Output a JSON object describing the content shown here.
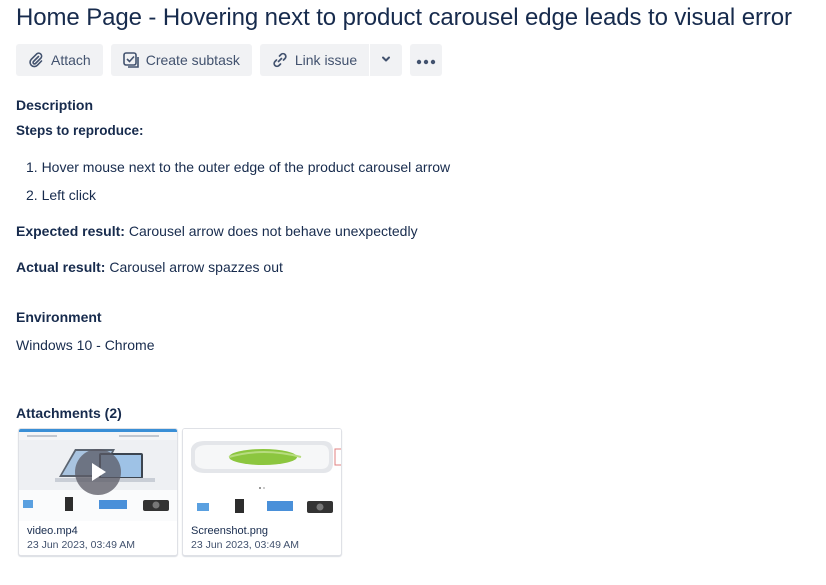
{
  "issue": {
    "title": "Home Page - Hovering next to product carousel edge leads to visual error"
  },
  "toolbar": {
    "attach_label": "Attach",
    "create_subtask_label": "Create subtask",
    "link_issue_label": "Link issue"
  },
  "description": {
    "heading": "Description",
    "steps_heading": "Steps to reproduce:",
    "steps": [
      "1. Hover mouse next to the outer edge of the product carousel arrow",
      "2. Left click"
    ],
    "expected_label": "Expected result:",
    "expected_value": "Carousel arrow does not behave unexpectedly",
    "actual_label": "Actual result:",
    "actual_value": "Carousel arrow spazzes out"
  },
  "environment": {
    "heading": "Environment",
    "value": "Windows 10 - Chrome"
  },
  "attachments": {
    "heading": "Attachments (2)",
    "items": [
      {
        "name": "video.mp4",
        "date": "23 Jun 2023, 03:49 AM",
        "icon": "play-icon"
      },
      {
        "name": "Screenshot.png",
        "date": "23 Jun 2023, 03:49 AM"
      }
    ]
  },
  "icons": [
    "paperclip-icon",
    "subtask-icon",
    "link-icon",
    "chevron-down-icon",
    "more-icon",
    "play-icon"
  ],
  "colors": {
    "text": "#172b4d",
    "button_bg": "#f1f2f4",
    "button_text": "#42526e"
  }
}
